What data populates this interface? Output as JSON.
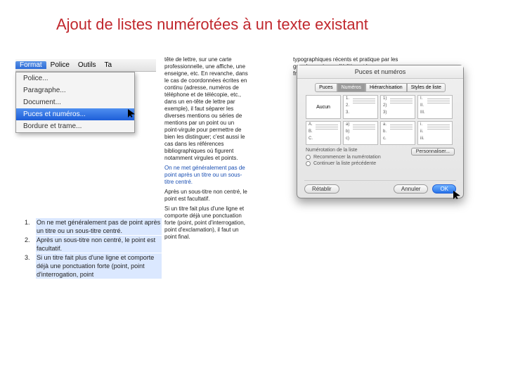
{
  "title": "Ajout de listes numérotées à un texte existant",
  "menubar": {
    "format": "Format",
    "police": "Police",
    "outils": "Outils",
    "last": "Ta"
  },
  "menu": {
    "police": "Police...",
    "paragraphe": "Paragraphe...",
    "document": "Document...",
    "puces": "Puces et numéros...",
    "bordure": "Bordure et trame..."
  },
  "doc": {
    "c1p1": "tête de lettre, sur une carte professionnelle, une affiche, une enseigne, etc. En revanche, dans le cas de coordonnées écrites en continu (adresse, numéros de téléphone et de télécopie, etc., dans un en-tête de lettre par exemple), il faut séparer les diverses mentions ou séries de mentions par un point ou un point-virgule pour permettre de bien les distinguer; c'est aussi le cas dans les références bibliographiques où figurent notamment virgules et points.",
    "c1p2": "On ne met généralement pas de point après un titre ou un sous-titre centré.",
    "c1p3": "Après un sous-titre non centré, le point est facultatif.",
    "c1p4": "Si un titre fait plus d'une ligne et comporte déjà une ponctuation forte (point, point d'interrogation, point d'exclamation), il faut un point final.",
    "c2p1": "typographiques récents et pratique par les grandes maisons d'édition et la presse francophone. L'emploi des"
  },
  "dialog": {
    "title": "Puces et numéros",
    "tabs": {
      "puces": "Puces",
      "numeros": "Numéros",
      "hier": "Hiérarchisation",
      "styles": "Styles de liste"
    },
    "cells": {
      "aucun": "Aucun",
      "n1": "1.",
      "n2": "2.",
      "n3": "3.",
      "p1": "1)",
      "p2": "2)",
      "p3": "3)",
      "r1": "I.",
      "r2": "II.",
      "r3": "III.",
      "A1": "A.",
      "A2": "B.",
      "A3": "C.",
      "a1": "a)",
      "a2": "b)",
      "a3": "c)",
      "l1": "a.",
      "l2": "b.",
      "l3": "c.",
      "i1": "i.",
      "i2": "ii.",
      "i3": "iii."
    },
    "section": "Numérotation de la liste",
    "opt1": "Recommencer la numérotation",
    "opt2": "Continuer la liste précédente",
    "personnaliser": "Personnaliser...",
    "retablir": "Rétablir",
    "annuler": "Annuler",
    "ok": "OK"
  },
  "list": {
    "i1n": "1.",
    "i1t": "On ne met généralement pas de point après un titre ou un sous-titre centré.",
    "i2n": "2.",
    "i2t": "Après un sous-titre non centré, le point est facultatif.",
    "i3n": "3.",
    "i3t": "Si un titre fait plus d'une ligne et comporte déjà une ponctuation forte (point, point d'interrogation, point"
  }
}
